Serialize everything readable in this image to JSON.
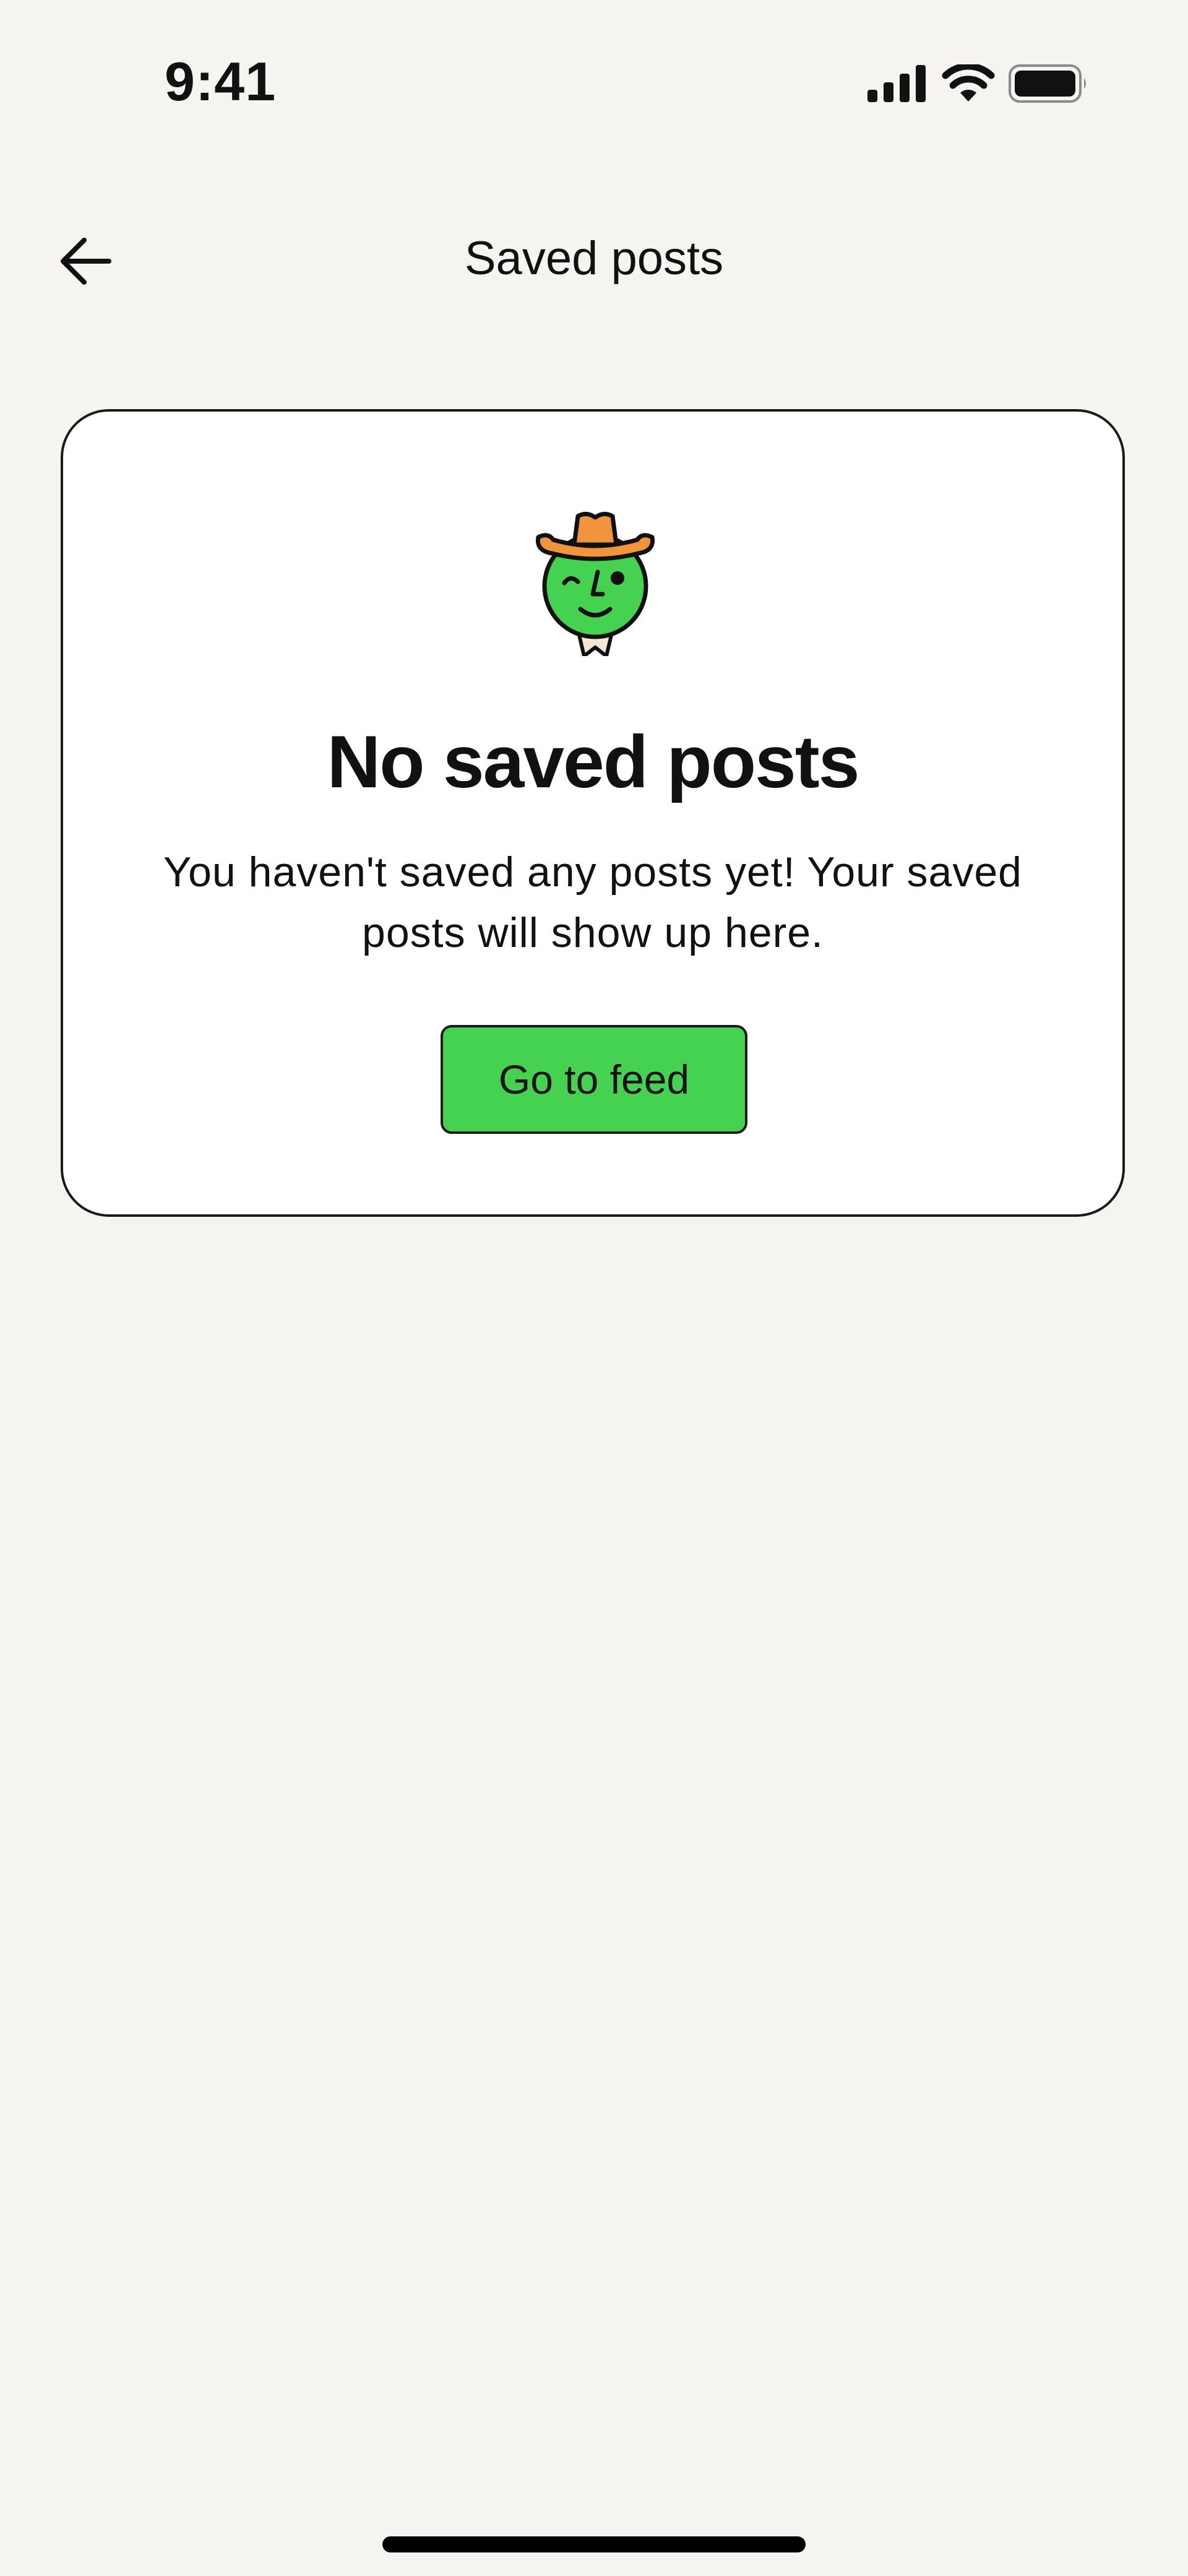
{
  "status_bar": {
    "time": "9:41",
    "icons": [
      "cellular-signal-icon",
      "wifi-icon",
      "battery-icon"
    ]
  },
  "nav": {
    "back_icon": "arrow-left-icon",
    "title": "Saved posts"
  },
  "empty_state": {
    "illustration": "cowboy-smiley-icon",
    "title": "No saved posts",
    "message": "You haven't saved any posts yet! Your saved posts will show up here.",
    "button_label": "Go to feed"
  },
  "colors": {
    "background": "#f5f4f0",
    "card": "#ffffff",
    "button_green": "#46d251",
    "face_green": "#46d251",
    "hat_orange": "#f0953c"
  }
}
